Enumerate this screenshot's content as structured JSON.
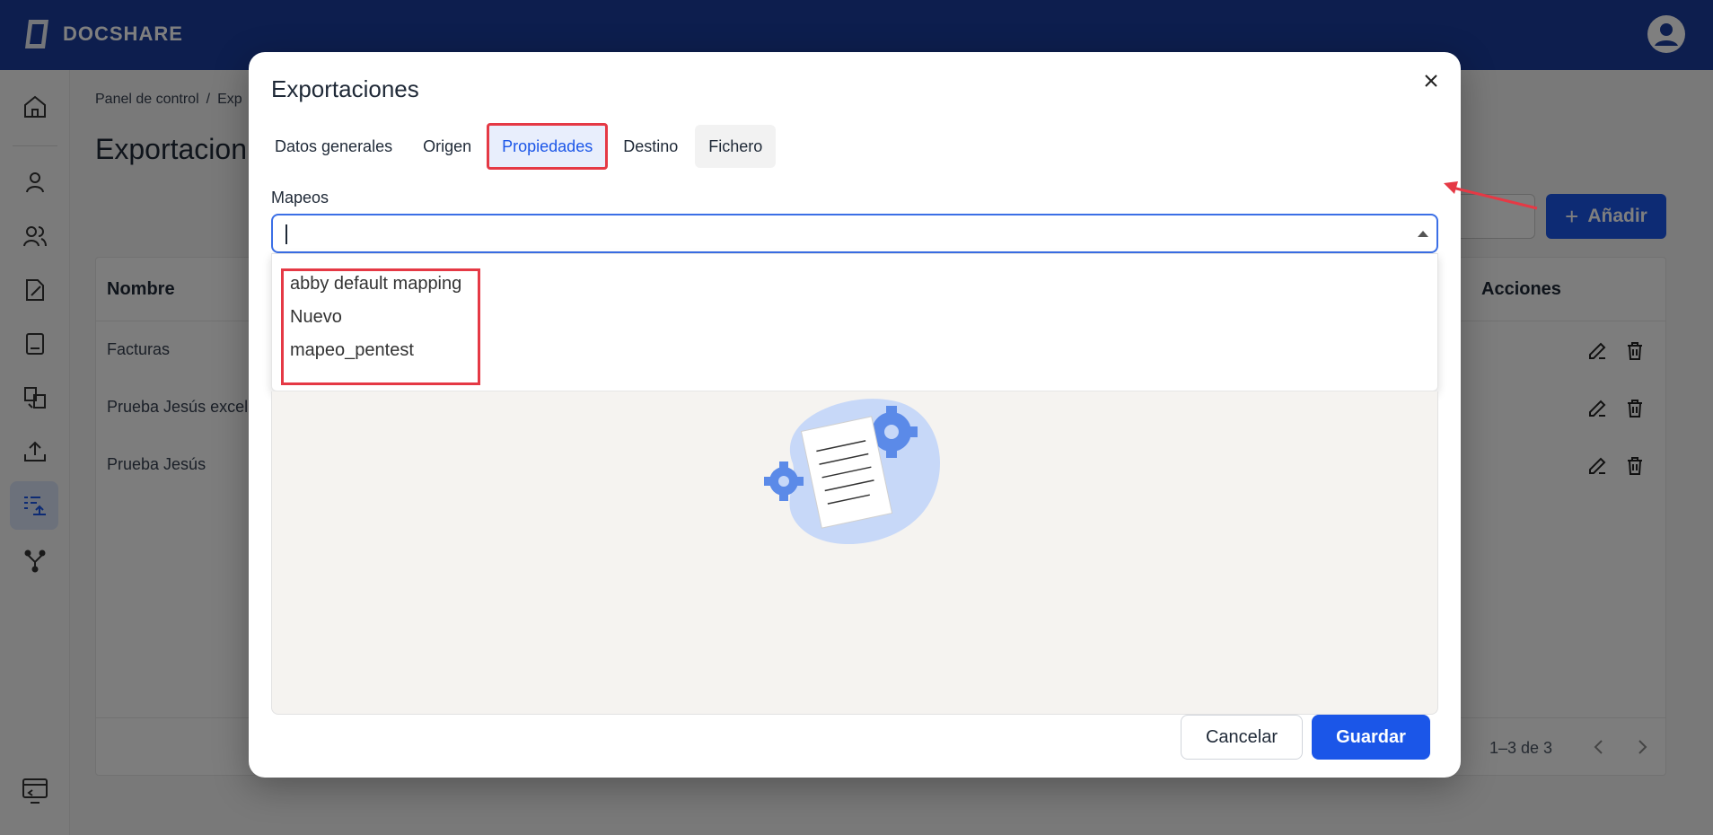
{
  "app": {
    "name": "DOCSHARE"
  },
  "breadcrumb": {
    "home": "Panel de control",
    "separator": "/",
    "current": "Exp"
  },
  "page": {
    "title": "Exportacion"
  },
  "toolbar": {
    "add_label": "Añadir"
  },
  "table": {
    "headers": {
      "name": "Nombre",
      "actions": "Acciones"
    },
    "rows": [
      {
        "name": "Facturas"
      },
      {
        "name": "Prueba Jesús excel"
      },
      {
        "name": "Prueba Jesús"
      }
    ],
    "pagination": "1–3 de 3"
  },
  "dialog": {
    "title": "Exportaciones",
    "tabs": [
      {
        "label": "Datos generales"
      },
      {
        "label": "Origen"
      },
      {
        "label": "Propiedades"
      },
      {
        "label": "Destino"
      },
      {
        "label": "Fichero"
      }
    ],
    "active_tab": "Propiedades",
    "field_label": "Mapeos",
    "field_value": "",
    "options": [
      {
        "label": "abby default mapping"
      },
      {
        "label": "Nuevo"
      },
      {
        "label": "mapeo_pentest"
      }
    ],
    "cancel_label": "Cancelar",
    "save_label": "Guardar"
  },
  "colors": {
    "brand": "#1a3d9c",
    "primary": "#1b56e8",
    "highlight": "#e53945"
  }
}
